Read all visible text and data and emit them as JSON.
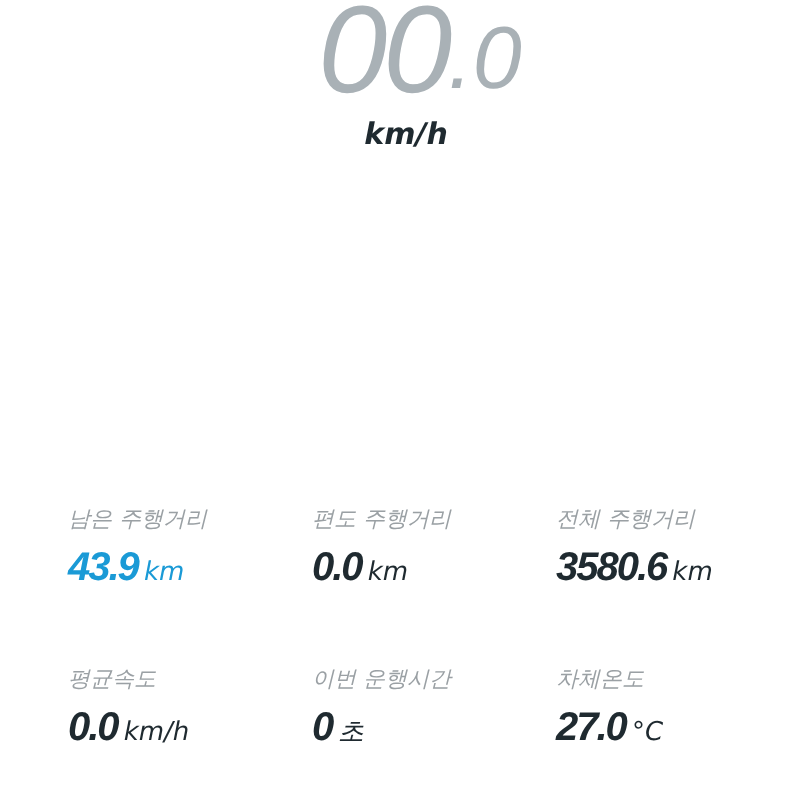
{
  "speed": {
    "whole": "00",
    "fraction": ".0",
    "unit": "km/h"
  },
  "stats": [
    {
      "label": "남은 주행거리",
      "value": "43.9",
      "unit": "km",
      "color": "#1a9ad6"
    },
    {
      "label": "편도 주행거리",
      "value": "0.0",
      "unit": "km",
      "color": "#1f2a30"
    },
    {
      "label": "전체 주행거리",
      "value": "3580.6",
      "unit": "km",
      "color": "#1f2a30"
    },
    {
      "label": "평균속도",
      "value": "0.0",
      "unit": "km/h",
      "color": "#1f2a30"
    },
    {
      "label": "이번 운행시간",
      "value": "0",
      "unit": "초",
      "color": "#1f2a30"
    },
    {
      "label": "차체온도",
      "value": "27.0",
      "unit": "°C",
      "color": "#1f2a30"
    }
  ]
}
